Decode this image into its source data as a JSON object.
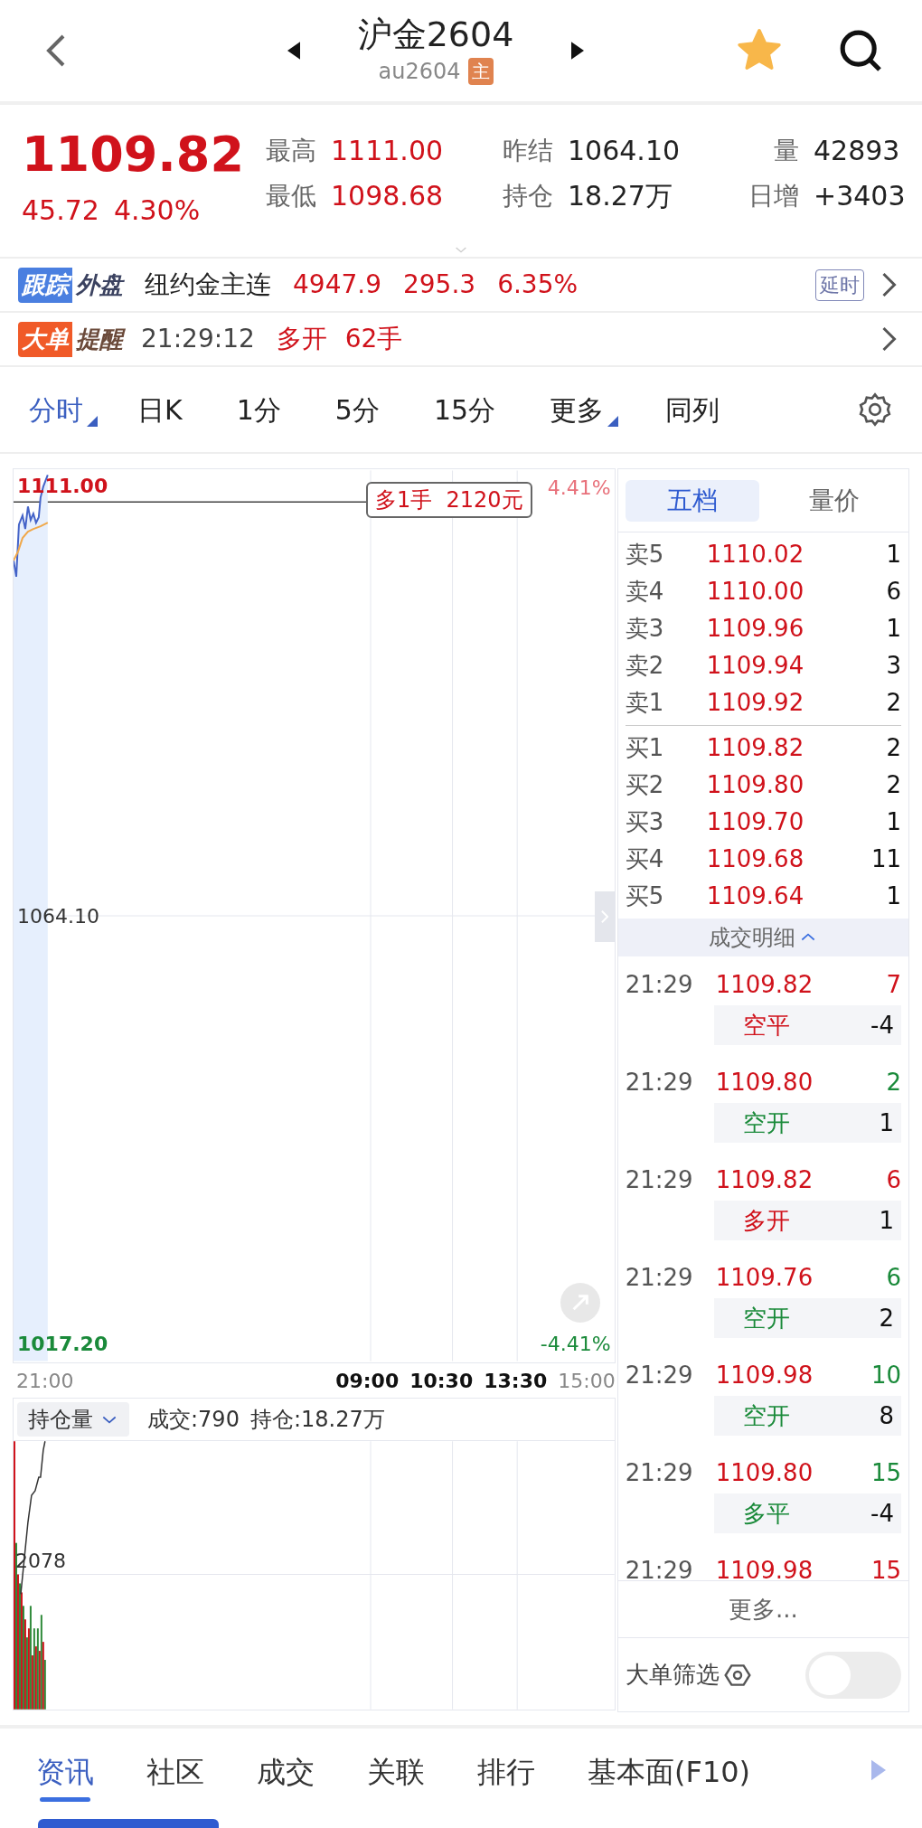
{
  "header": {
    "title": "沪金2604",
    "code": "au2604",
    "badge": "主",
    "favorite": true
  },
  "quote": {
    "price": "1109.82",
    "change": "45.72",
    "change_pct": "4.30%",
    "stats": [
      {
        "label": "最高",
        "value": "1111.00",
        "color": "#d0121b"
      },
      {
        "label": "昨结",
        "value": "1064.10",
        "color": "#222222"
      },
      {
        "label": "量",
        "value": "42893",
        "color": "#222222"
      },
      {
        "label": "最低",
        "value": "1098.68",
        "color": "#d0121b"
      },
      {
        "label": "持仓",
        "value": "18.27万",
        "color": "#222222"
      },
      {
        "label": "日增",
        "value": "+3403",
        "color": "#222222"
      }
    ]
  },
  "foreign": {
    "tag_1": "跟踪",
    "tag_2": "外盘",
    "name": "纽约金主连",
    "price": "4947.9",
    "change": "295.3",
    "change_pct": "6.35%",
    "badge": "延时"
  },
  "alert": {
    "tag_1": "大单",
    "tag_2": "提醒",
    "time": "21:29:12",
    "action": "多开",
    "amount": "62手"
  },
  "period_tabs": [
    {
      "label": "分时",
      "selected": true,
      "dropdown": true
    },
    {
      "label": "日K",
      "selected": false,
      "dropdown": false
    },
    {
      "label": "1分",
      "selected": false,
      "dropdown": false
    },
    {
      "label": "5分",
      "selected": false,
      "dropdown": false
    },
    {
      "label": "15分",
      "selected": false,
      "dropdown": false
    },
    {
      "label": "更多",
      "selected": false,
      "dropdown": true
    },
    {
      "label": "同列",
      "selected": false,
      "dropdown": false
    }
  ],
  "chart": {
    "high": "1111.00",
    "mid": "1064.10",
    "low": "1017.20",
    "high_pct": "4.41%",
    "low_pct": "-4.41%",
    "order_tag": "多1手  2120元",
    "time_labels": [
      {
        "label": "21:00",
        "dim": true
      },
      {
        "label": "09:00",
        "dim": false
      },
      {
        "label": "10:30",
        "dim": false
      },
      {
        "label": "13:30",
        "dim": false
      },
      {
        "label": "15:00",
        "dim": true
      }
    ]
  },
  "volume": {
    "selector": "持仓量",
    "volume": "成交:790",
    "open_interest": "持仓:18.27万",
    "axis_label": "2078"
  },
  "order_book": {
    "tabs": [
      {
        "label": "五档",
        "selected": true
      },
      {
        "label": "量价",
        "selected": false
      }
    ],
    "asks": [
      {
        "label": "卖5",
        "price": "1110.02",
        "qty": "1"
      },
      {
        "label": "卖4",
        "price": "1110.00",
        "qty": "6"
      },
      {
        "label": "卖3",
        "price": "1109.96",
        "qty": "1"
      },
      {
        "label": "卖2",
        "price": "1109.94",
        "qty": "3"
      },
      {
        "label": "卖1",
        "price": "1109.92",
        "qty": "2"
      }
    ],
    "bids": [
      {
        "label": "买1",
        "price": "1109.82",
        "qty": "2"
      },
      {
        "label": "买2",
        "price": "1109.80",
        "qty": "2"
      },
      {
        "label": "买3",
        "price": "1109.70",
        "qty": "1"
      },
      {
        "label": "买4",
        "price": "1109.68",
        "qty": "11"
      },
      {
        "label": "买5",
        "price": "1109.64",
        "qty": "1"
      }
    ]
  },
  "trades": {
    "title": "成交明细",
    "rows": [
      {
        "time": "21:29",
        "price": "1109.82",
        "volume": "7",
        "color": "#d0121b",
        "type": "空平",
        "delta": "-4"
      },
      {
        "time": "21:29",
        "price": "1109.80",
        "volume": "2",
        "color": "#1a8a3a",
        "type": "空开",
        "delta": "1"
      },
      {
        "time": "21:29",
        "price": "1109.82",
        "volume": "6",
        "color": "#d0121b",
        "type": "多开",
        "delta": "1"
      },
      {
        "time": "21:29",
        "price": "1109.76",
        "volume": "6",
        "color": "#1a8a3a",
        "type": "空开",
        "delta": "2"
      },
      {
        "time": "21:29",
        "price": "1109.98",
        "volume": "10",
        "color": "#1a8a3a",
        "type": "空开",
        "delta": "8"
      },
      {
        "time": "21:29",
        "price": "1109.80",
        "volume": "15",
        "color": "#1a8a3a",
        "type": "多平",
        "delta": "-4"
      },
      {
        "time": "21:29",
        "price": "1109.98",
        "volume": "15",
        "color": "#d0121b"
      }
    ],
    "more": "更多...",
    "filter": {
      "label": "大单筛选",
      "on": false
    }
  },
  "bottom_tabs": [
    {
      "label": "资讯",
      "selected": true
    },
    {
      "label": "社区",
      "selected": false
    },
    {
      "label": "成交",
      "selected": false
    },
    {
      "label": "关联",
      "selected": false
    },
    {
      "label": "排行",
      "selected": false
    },
    {
      "label": "基本面(F10)",
      "selected": false
    }
  ]
}
